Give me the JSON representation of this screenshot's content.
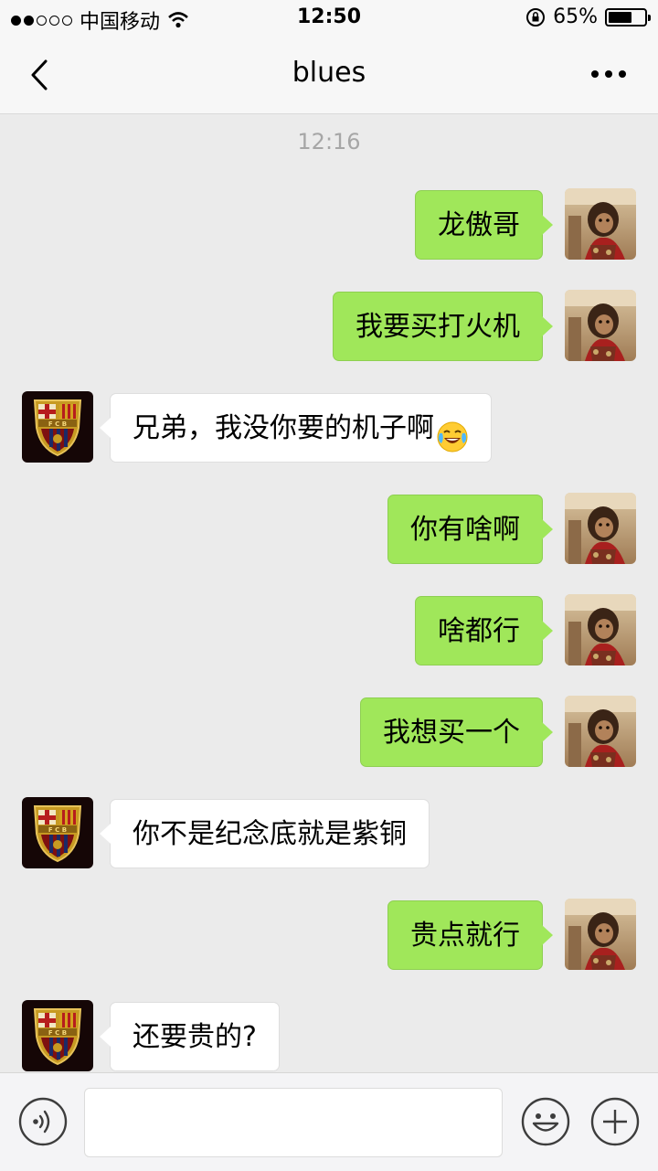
{
  "status_bar": {
    "carrier": "中国移动",
    "time": "12:50",
    "battery": "65%",
    "battery_level": 0.65
  },
  "nav": {
    "title": "blues",
    "back_icon": "chevron-left-icon",
    "more_icon": "more-dots-icon"
  },
  "chat": {
    "timestamp": "12:16",
    "messages": [
      {
        "side": "right",
        "text": "龙傲哥"
      },
      {
        "side": "right",
        "text": "我要买打火机"
      },
      {
        "side": "left",
        "text": "兄弟，我没你要的机子啊",
        "emoji": "laughing-crying-emoji"
      },
      {
        "side": "right",
        "text": "你有啥啊"
      },
      {
        "side": "right",
        "text": "啥都行"
      },
      {
        "side": "right",
        "text": "我想买一个"
      },
      {
        "side": "left",
        "text": "你不是纪念底就是紫铜"
      },
      {
        "side": "right",
        "text": "贵点就行"
      },
      {
        "side": "left",
        "text": "还要贵的?"
      }
    ]
  },
  "input_bar": {
    "value": "",
    "voice_icon": "voice-icon",
    "emoji_icon": "emoji-icon",
    "plus_icon": "plus-icon"
  },
  "colors": {
    "sent_bubble": "#a0e75a",
    "received_bubble": "#ffffff",
    "background": "#ebebeb"
  }
}
